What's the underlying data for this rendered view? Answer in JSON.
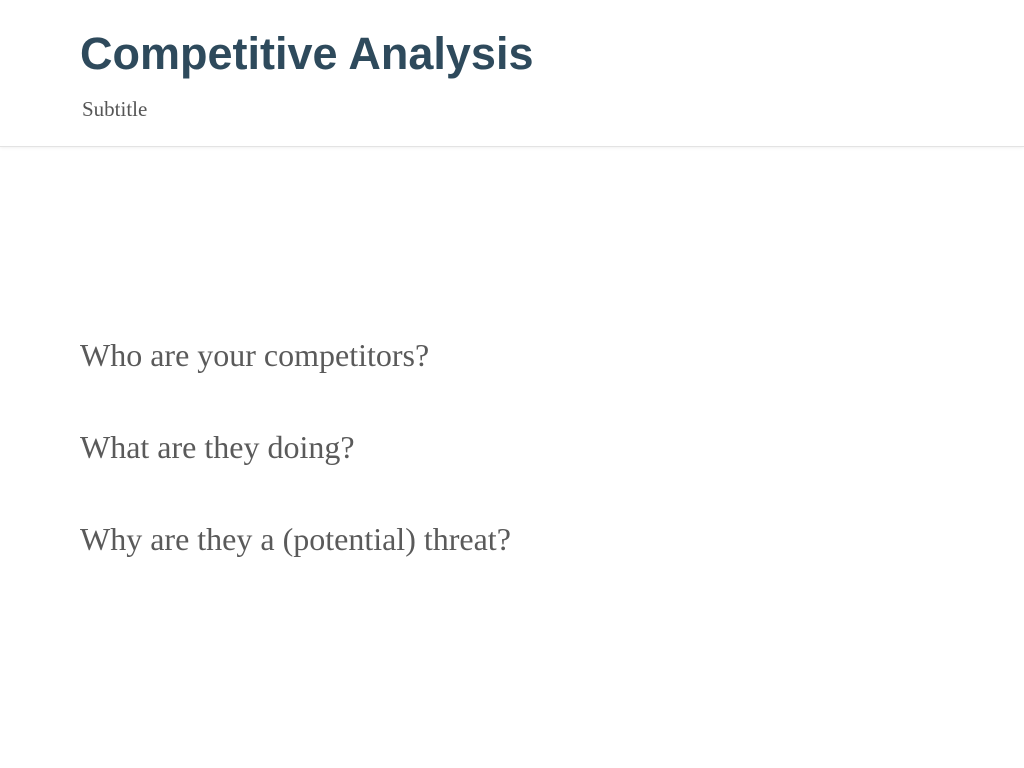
{
  "slide": {
    "title": "Competitive Analysis",
    "subtitle": "Subtitle",
    "bullets": [
      "Who are your competitors?",
      "What are they doing?",
      "Why are they a (potential) threat?"
    ]
  },
  "colors": {
    "title": "#2e4a5c",
    "body_text": "#5a5a5a",
    "subtitle": "#555555",
    "background": "#ffffff"
  }
}
